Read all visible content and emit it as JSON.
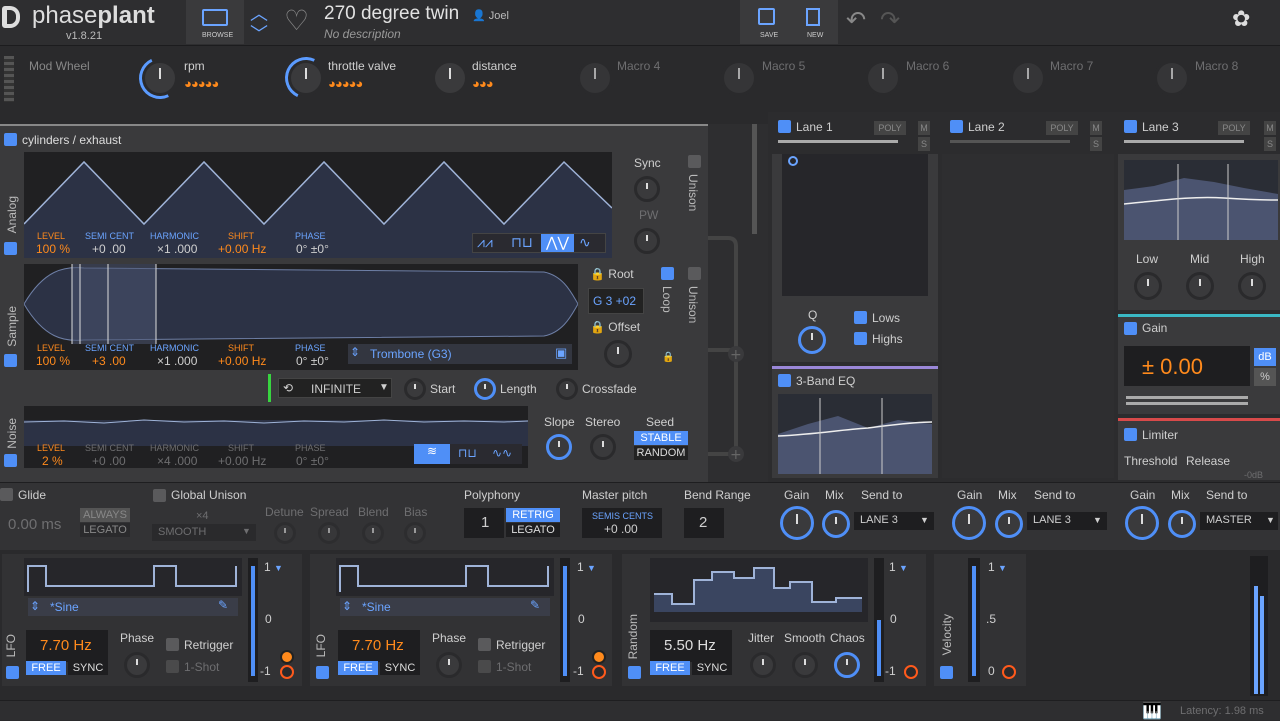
{
  "app": {
    "name_a": "phase",
    "name_b": "plant",
    "version": "v1.8.21",
    "browse": "BROWSE",
    "save": "SAVE",
    "new": "NEW"
  },
  "preset": {
    "title": "270 degree twin",
    "author": "Joel",
    "description": "No description"
  },
  "macros": [
    {
      "label": "Mod Wheel"
    },
    {
      "label": "rpm"
    },
    {
      "label": "throttle valve"
    },
    {
      "label": "distance"
    },
    {
      "label": "Macro 4"
    },
    {
      "label": "Macro 5"
    },
    {
      "label": "Macro 6"
    },
    {
      "label": "Macro 7"
    },
    {
      "label": "Macro 8"
    }
  ],
  "generator": {
    "title": "cylinders / exhaust",
    "analog": {
      "label": "Analog",
      "level_h": "LEVEL",
      "level": "100 %",
      "semi_h": "SEMI CENT",
      "semi": "+0 .00",
      "harm_h": "HARMONIC",
      "harm": "×1 .000",
      "shift_h": "SHIFT",
      "shift": "+0.00 Hz",
      "phase_h": "PHASE",
      "phase": "0° ±0°",
      "sync": "Sync",
      "pw": "PW",
      "unison": "Unison"
    },
    "sample": {
      "label": "Sample",
      "level": "100 %",
      "semi": "+3 .00",
      "harm": "×1 .000",
      "shift": "+0.00 Hz",
      "phase": "0° ±0°",
      "name": "Trombone (G3)",
      "root_h": "Root",
      "root": "G 3 +02",
      "offset": "Offset",
      "loop": "Loop",
      "unison": "Unison",
      "mode": "INFINITE",
      "start": "Start",
      "length": "Length",
      "crossfade": "Crossfade"
    },
    "noise": {
      "label": "Noise",
      "level": "2 %",
      "semi": "+0 .00",
      "harm": "×4 .000",
      "shift": "+0.00 Hz",
      "phase": "0° ±0°",
      "slope": "Slope",
      "stereo": "Stereo",
      "seed": "Seed",
      "stable": "STABLE",
      "random": "RANDOM"
    }
  },
  "lanes": [
    {
      "name": "Lane 1",
      "poly": "POLY"
    },
    {
      "name": "Lane 2",
      "poly": "POLY"
    },
    {
      "name": "Lane 3",
      "poly": "POLY"
    }
  ],
  "lane1": {
    "q": "Q",
    "lows": "Lows",
    "highs": "Highs",
    "eq": "3-Band EQ"
  },
  "lane3": {
    "low": "Low",
    "mid": "Mid",
    "high": "High",
    "gain": "Gain",
    "gain_value": "± 0.00",
    "db": "dB",
    "pct": "%",
    "limiter": "Limiter",
    "threshold": "Threshold",
    "release": "Release",
    "db2": "-0dB"
  },
  "bottom": {
    "glide": "Glide",
    "glide_val": "0.00 ms",
    "always": "ALWAYS",
    "legato": "LEGATO",
    "gunison": "Global Unison",
    "x4": "×4",
    "smooth": "SMOOTH",
    "detune": "Detune",
    "spread": "Spread",
    "blend": "Blend",
    "bias": "Bias",
    "poly": "Polyphony",
    "poly_val": "1",
    "retrig": "RETRIG",
    "legato2": "LEGATO",
    "master_pitch": "Master pitch",
    "semis": "SEMIS CENTS",
    "semis_val": "+0 .00",
    "bend": "Bend Range",
    "bend_val": "2",
    "sends": [
      {
        "gain": "Gain",
        "mix": "Mix",
        "to": "Send to",
        "dest": "LANE 3"
      },
      {
        "gain": "Gain",
        "mix": "Mix",
        "to": "Send to",
        "dest": "LANE 3"
      },
      {
        "gain": "Gain",
        "mix": "Mix",
        "to": "Send to",
        "dest": "MASTER"
      }
    ]
  },
  "mods": [
    {
      "type": "LFO",
      "shape": "*Sine",
      "rate": "7.70 Hz",
      "free": "FREE",
      "sync": "SYNC",
      "phase": "Phase",
      "retrig": "Retrigger",
      "oneshot": "1-Shot",
      "hi": "1",
      "mid": "0",
      "lo": "-1"
    },
    {
      "type": "LFO",
      "shape": "*Sine",
      "rate": "7.70 Hz",
      "free": "FREE",
      "sync": "SYNC",
      "phase": "Phase",
      "retrig": "Retrigger",
      "oneshot": "1-Shot",
      "hi": "1",
      "mid": "0",
      "lo": "-1"
    },
    {
      "type": "Random",
      "rate": "5.50 Hz",
      "free": "FREE",
      "sync": "SYNC",
      "jitter": "Jitter",
      "smooth": "Smooth",
      "chaos": "Chaos",
      "hi": "1",
      "mid": "0",
      "lo": "-1"
    },
    {
      "type": "Velocity",
      "hi": "1",
      "mid": ".5",
      "lo": "0"
    }
  ],
  "status": {
    "latency": "Latency: 1.98 ms"
  }
}
